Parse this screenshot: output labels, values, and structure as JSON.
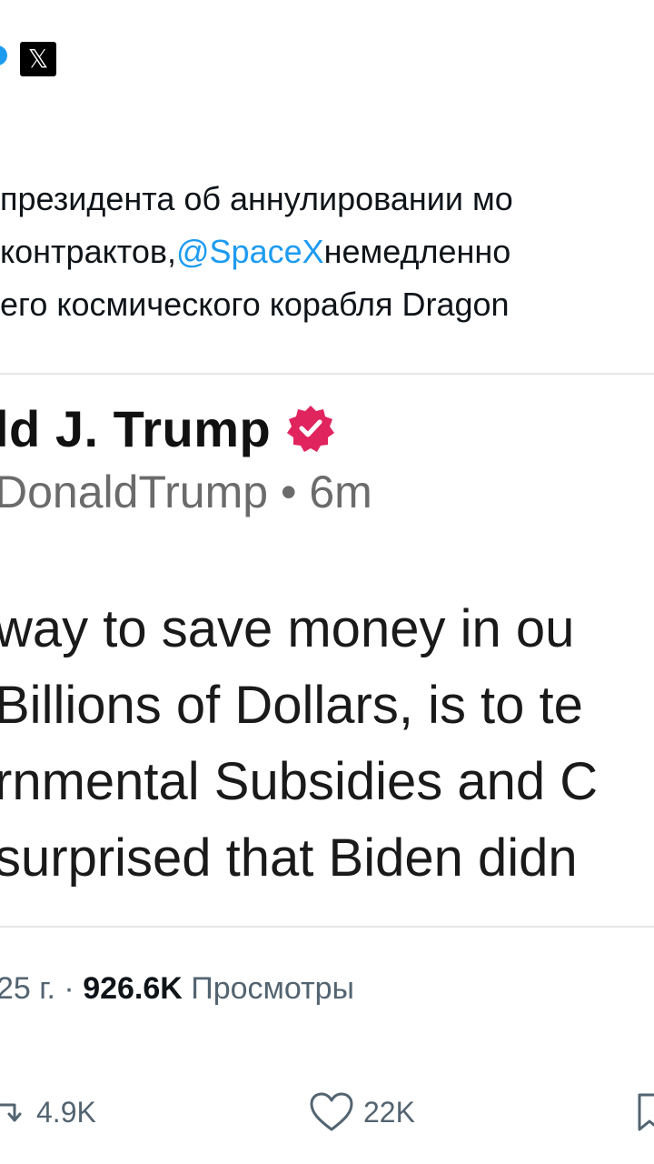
{
  "header": {
    "x_logo": "𝕏",
    "icons": [
      "verified-icon",
      "x-logo-icon"
    ]
  },
  "tweet": {
    "lines": [
      "президента об аннулировании мо",
      "контрактов,",
      "немедленно",
      "его космического корабля Dragon"
    ],
    "mention": "@SpaceX"
  },
  "quote": {
    "name": "ld J. Trump",
    "handle": "DonaldTrump • 6m",
    "body": [
      "way to save money in ou",
      "Billions of Dollars, is to te",
      "rnmental Subsidies and C",
      "surprised that Biden didn"
    ]
  },
  "meta": {
    "date_fragment": "25 г. · ",
    "views_count": "926.6K",
    "views_label": " Просмотры"
  },
  "actions": {
    "retweets": "4.9K",
    "likes": "22K"
  },
  "colors": {
    "accent": "#1d9bf0",
    "badge": "#e0245e",
    "text": "#0f1419",
    "muted": "#536471"
  }
}
